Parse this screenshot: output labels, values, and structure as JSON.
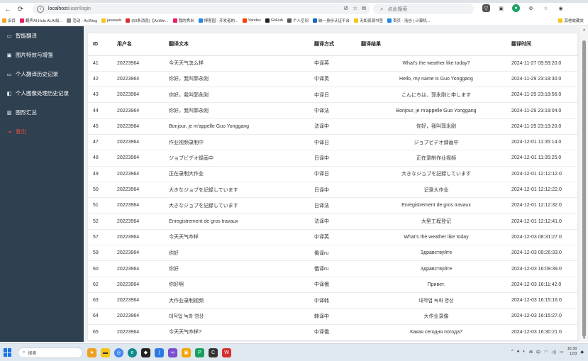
{
  "browser": {
    "url_host": "localhost",
    "url_path": "/user/login",
    "search_placeholder": "点此搜索",
    "bookmarks": [
      {
        "label": "旧目",
        "color": "#f5a623"
      },
      {
        "label": "翻声AI,Hulu ALAI绘...",
        "color": "#e91e63"
      },
      {
        "label": "活动 - AcWing",
        "color": "#888"
      },
      {
        "label": "javaweb",
        "color": "#f5c518"
      },
      {
        "label": "(60条消息)【AcWin...",
        "color": "#d32f2f"
      },
      {
        "label": "我的秀米",
        "color": "#e91e63"
      },
      {
        "label": "博客园 - 开发者的...",
        "color": "#1e88e5"
      },
      {
        "label": "Yandex",
        "color": "#ff3d00"
      },
      {
        "label": "GitHub",
        "color": "#222"
      },
      {
        "label": "个人空间",
        "color": "#555"
      },
      {
        "label": "统一身份认证平台",
        "color": "#1565c0"
      },
      {
        "label": "无知资源书签",
        "color": "#f5c518"
      },
      {
        "label": "首页 - 洛谷 | 计算机...",
        "color": "#1e88e5"
      }
    ],
    "bookmarks_more": "其他收藏夹"
  },
  "sidebar": {
    "items": [
      {
        "label": "智能翻译",
        "icon": "translate-icon"
      },
      {
        "label": "图片特效与增强",
        "icon": "image-effects-icon"
      },
      {
        "label": "个人翻译历史记录",
        "icon": "history-icon"
      },
      {
        "label": "个人图像处理历史记录",
        "icon": "image-history-icon"
      },
      {
        "label": "图形汇总",
        "icon": "chart-icon"
      }
    ],
    "logout": "登出",
    "accent": "#e8513f"
  },
  "table": {
    "headers": [
      "ID",
      "用户名",
      "翻译文本",
      "翻译方式",
      "翻译结果",
      "翻译时间"
    ],
    "rows": [
      [
        "41",
        "20223964",
        "今天天气怎么样",
        "中译英",
        "What's the weather like today?",
        "2024-11-27 09:59:20.0"
      ],
      [
        "42",
        "20223964",
        "你好，我叫郭永刚",
        "中译英",
        "Hello, my name is Guo Yonggang",
        "2024-11-29 23:18:30.0"
      ],
      [
        "43",
        "20223964",
        "你好，我叫郭永刚",
        "中译日",
        "こんにちは、郭永剛と申します",
        "2024-11-29 23:18:56.0"
      ],
      [
        "44",
        "20223964",
        "你好，我叫郭永刚",
        "中译法",
        "Bonjour, je m'appelle Guo Yonggang",
        "2024-11-29 23:19:04.0"
      ],
      [
        "45",
        "20223964",
        "Bonjour, je m'appelle Guo Yonggang",
        "法译中",
        "你好，我叫郭永刚",
        "2024-11-29 23:19:20.0"
      ],
      [
        "47",
        "20223964",
        "作业视频录制中",
        "中译日",
        "ジョブビデオ録画中",
        "2024-12-01 11:35:14.0"
      ],
      [
        "48",
        "20223964",
        "ジョブビデオ録画中",
        "日译中",
        "正在录制作业视频",
        "2024-12-01 11:35:25.0"
      ],
      [
        "49",
        "20223964",
        "正在录制大作业",
        "中译日",
        "大きなジョブを記録しています",
        "2024-12-01 12:12:12.0"
      ],
      [
        "50",
        "20223964",
        "大きなジョブを記録しています",
        "日译中",
        "记录大作业",
        "2024-12-01 12:12:22.0"
      ],
      [
        "51",
        "20223964",
        "大きなジョブを記録しています",
        "日译法",
        "Enregistrement de gros travaux",
        "2024-12-01 12:12:32.0"
      ],
      [
        "52",
        "20223964",
        "Enregistrement de gros travaux",
        "法译中",
        "大型工程登记",
        "2024-12-01 12:12:41.0"
      ],
      [
        "57",
        "20223964",
        "今天天气咋样",
        "中译英",
        "What's the weather like today",
        "2024-12-03 08:31:27.0"
      ],
      [
        "59",
        "20223964",
        "你好",
        "俄译ru",
        "Здравствуйте",
        "2024-12-03 09:26:33.0"
      ],
      [
        "60",
        "20223964",
        "你好",
        "俄译ru",
        "Здравствуйте",
        "2024-12-03 16:09:39.0"
      ],
      [
        "62",
        "20223964",
        "你好啊",
        "中译俄",
        "Привет.",
        "2024-12-03 16:11:42.0"
      ],
      [
        "63",
        "20223964",
        "大作业录制视频",
        "中译韩",
        "대작업 녹화 영상",
        "2024-12-03 16:15:16.0"
      ],
      [
        "64",
        "20223964",
        "대작업 녹화 영상",
        "韩译中",
        "大作业录像",
        "2024-12-03 16:15:27.0"
      ],
      [
        "65",
        "20223964",
        "今天天气咋样?",
        "中译俄",
        "Какая сегодня погода?",
        "2024-12-03 16:30:21.0"
      ]
    ]
  },
  "taskbar": {
    "search_placeholder": "搜索",
    "lang": "中",
    "time": "16:30",
    "date": "12/3"
  }
}
